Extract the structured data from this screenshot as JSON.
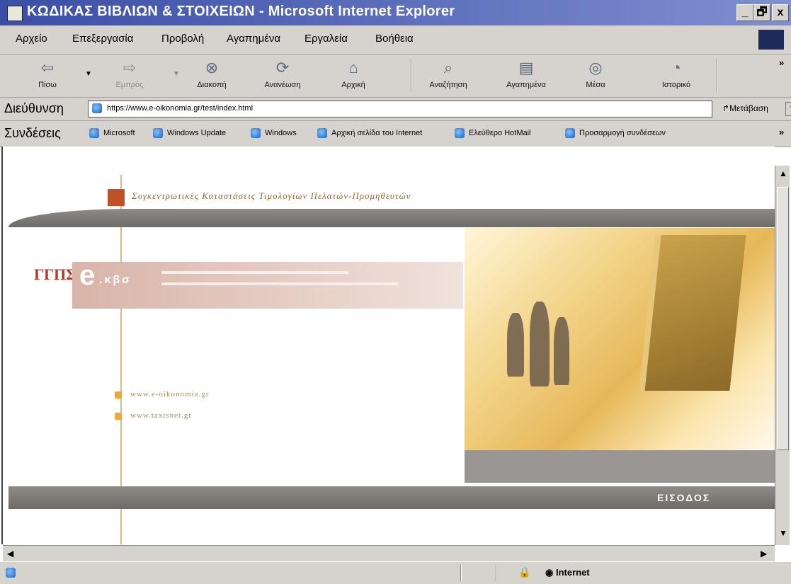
{
  "window": {
    "title": "ΚΩΔΙΚΑΣ ΒΙΒΛΙΩΝ & ΣΤΟΙΧΕΙΩΝ - Microsoft Internet Explorer",
    "min": "_",
    "max": "🗗",
    "close": "x"
  },
  "menu": [
    "Αρχείο",
    "Επεξεργασία",
    "Προβολή",
    "Αγαπημένα",
    "Εργαλεία",
    "Βοήθεια"
  ],
  "toolbar": {
    "back": "Πίσω",
    "forward": "Εμπρός",
    "stop": "Διακοπή",
    "refresh": "Ανανέωση",
    "home": "Αρχική",
    "search": "Αναζήτηση",
    "favorites": "Αγαπημένα",
    "media": "Μέσα",
    "history": "Ιστορικό",
    "more": "»"
  },
  "address": {
    "label": "Διεύθυνση",
    "url": "https://www.e-oikonomia.gr/test/index.html",
    "go": "Μετάβαση"
  },
  "links": {
    "label": "Συνδέσεις",
    "items": [
      "Microsoft",
      "Windows Update",
      "Windows",
      "Αρχική σελίδα του Internet",
      "Ελεύθερο HotMail",
      "Προσαρμογή συνδέσεων"
    ],
    "more": "»"
  },
  "page": {
    "header_title": "Συγκεντρωτικές Καταστάσεις Τιμολογίων Πελατών-Προμηθευτών",
    "brand_letter": "e",
    "brand_suffix": ".κβσ",
    "logo_text": "ΓΓΠΣ",
    "link1": "www.e-oikonomia.gr",
    "link2": "www.taxisnet.gr",
    "enter": "ΕΙΣΟΔΟΣ"
  },
  "status": {
    "zone": "Internet"
  }
}
